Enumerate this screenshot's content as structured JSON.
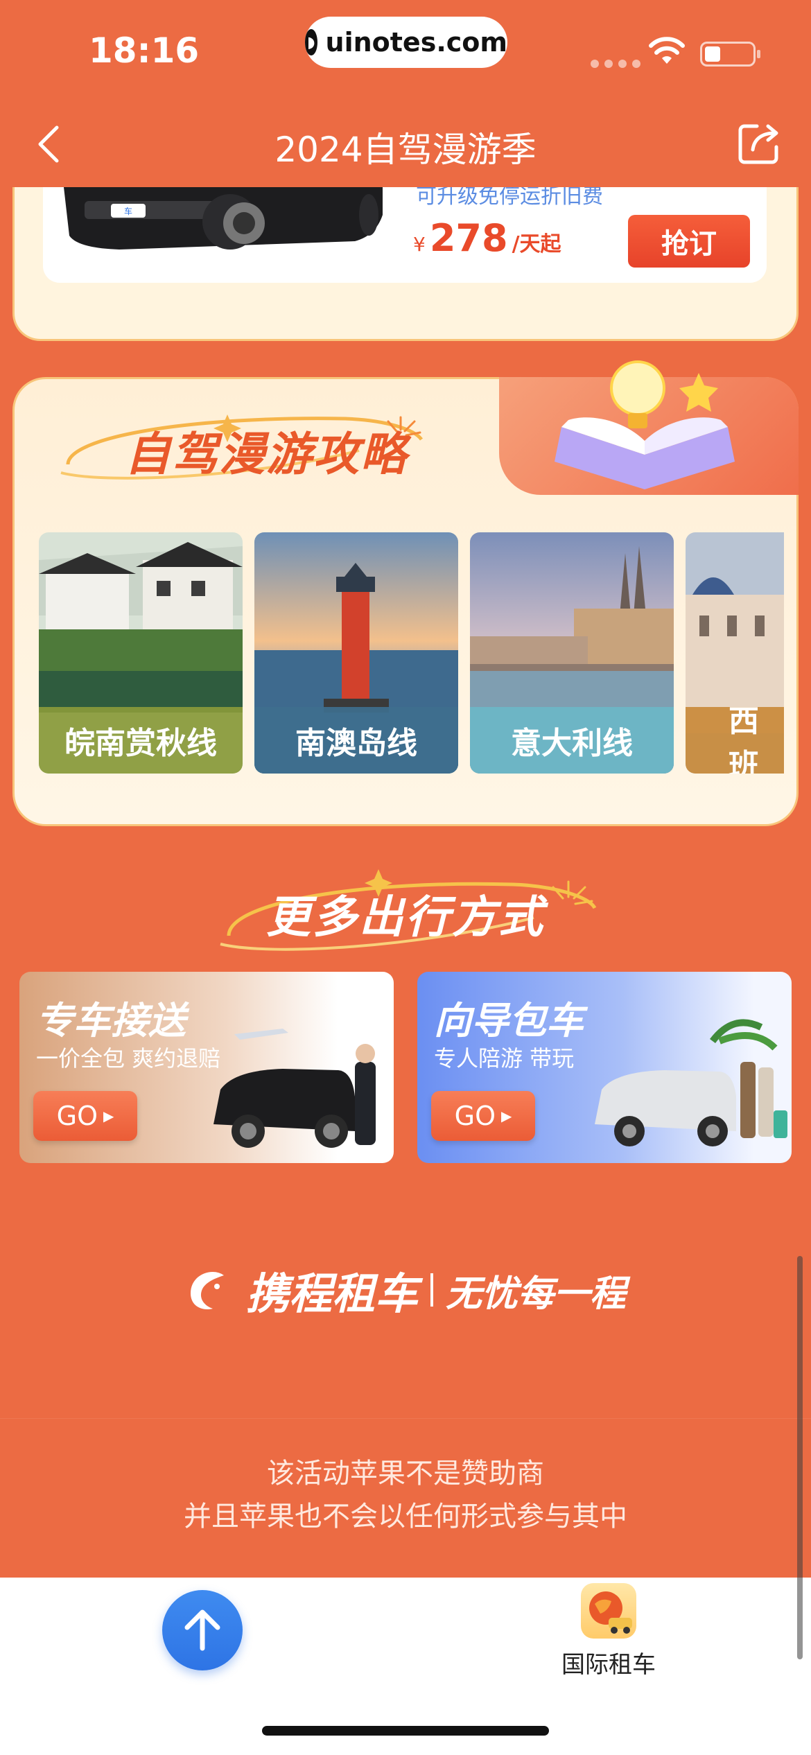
{
  "status_bar": {
    "time": "18:16",
    "url": "uinotes.com"
  },
  "nav": {
    "title": "2024自驾漫游季"
  },
  "product": {
    "upgrade_text": "可升级免停运折旧费",
    "price_symbol": "¥",
    "price_value": "278",
    "price_unit": "/天起",
    "book_label": "抢订"
  },
  "guide": {
    "title": "自驾漫游攻略",
    "destinations": [
      {
        "label": "皖南赏秋线",
        "label_color": "#8A9A3A"
      },
      {
        "label": "南澳岛线",
        "label_color": "#3E6F8E"
      },
      {
        "label": "意大利线",
        "label_color": "#6BB7C7"
      },
      {
        "label": "西班",
        "label_color": "#C98A3A"
      }
    ]
  },
  "more": {
    "title": "更多出行方式",
    "services": [
      {
        "title": "专车接送",
        "subtitle": "一价全包 爽约退赔",
        "go_label": "GO"
      },
      {
        "title": "向导包车",
        "subtitle": "专人陪游 带玩",
        "go_label": "GO"
      }
    ]
  },
  "brand": {
    "name": "携程租车",
    "slogan": "无忧每一程"
  },
  "disclaimer": {
    "line1": "该活动苹果不是赞助商",
    "line2": "并且苹果也不会以任何形式参与其中"
  },
  "bottom_bar": {
    "intl_label": "国际租车"
  },
  "colors": {
    "page_bg": "#EC6B43",
    "accent_red": "#E94A2A",
    "up_button_blue": "#2E74E5"
  }
}
